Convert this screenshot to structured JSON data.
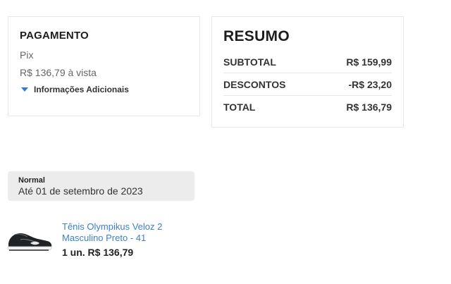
{
  "payment": {
    "title": "PAGAMENTO",
    "method": "Pix",
    "amount": "R$ 136,79 à vista",
    "more_info": "Informações Adicionais"
  },
  "summary": {
    "title": "RESUMO",
    "rows": [
      {
        "label": "SUBTOTAL",
        "value": "R$ 159,99"
      },
      {
        "label": "DESCONTOS",
        "value": "-R$ 23,20"
      },
      {
        "label": "TOTAL",
        "value": "R$ 136,79"
      }
    ]
  },
  "shipping": {
    "type": "Normal",
    "date": "Até 01 de setembro de 2023"
  },
  "product": {
    "name": "Tênis Olympikus Veloz 2 Masculino Preto - 41",
    "qty_price": "1 un. R$ 136,79",
    "icon": "shoe-image"
  },
  "colors": {
    "link": "#3b7fd0",
    "caret": "#2f7ccc",
    "shipping_bg": "#ececec"
  }
}
